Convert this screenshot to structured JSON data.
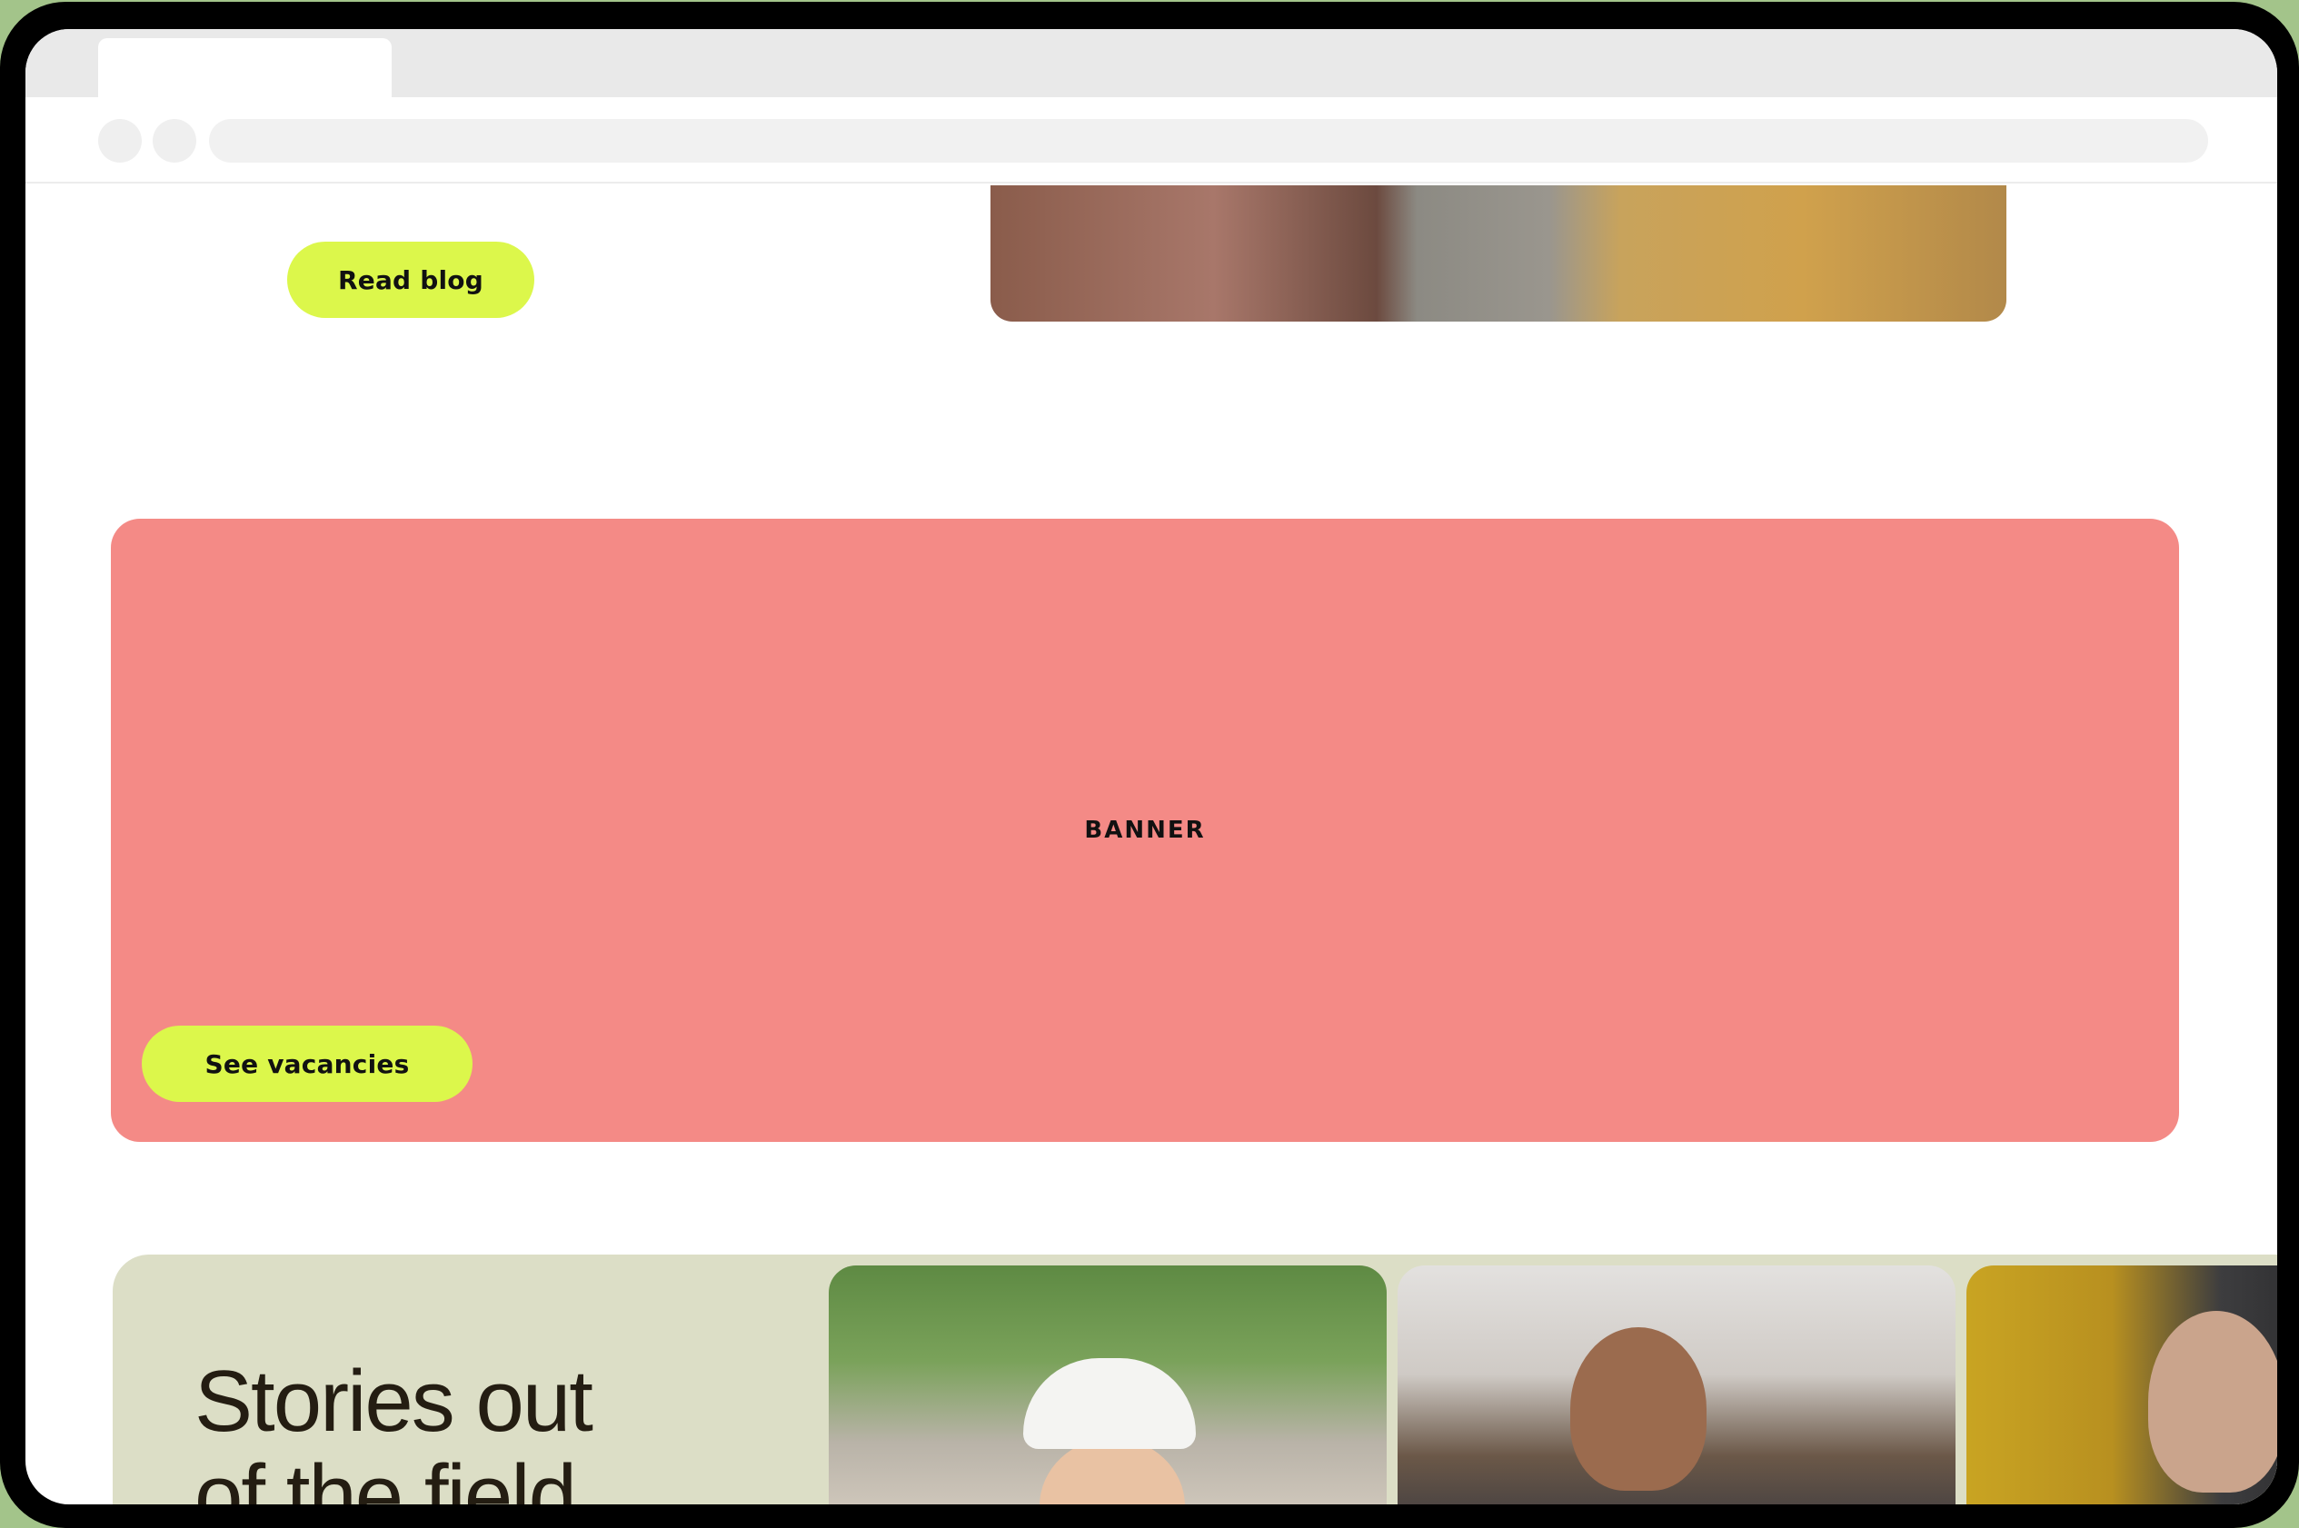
{
  "page": {
    "read_blog_label": "Read blog",
    "banner_label": "BANNER",
    "see_vacancies_label": "See vacancies",
    "stories_title_line1": "Stories out",
    "stories_title_line2": "of the field"
  },
  "colors": {
    "accent": "#dcf74b",
    "banner": "#f48a86",
    "stories_bg": "#dcdec6",
    "text_dark": "#241d12"
  }
}
